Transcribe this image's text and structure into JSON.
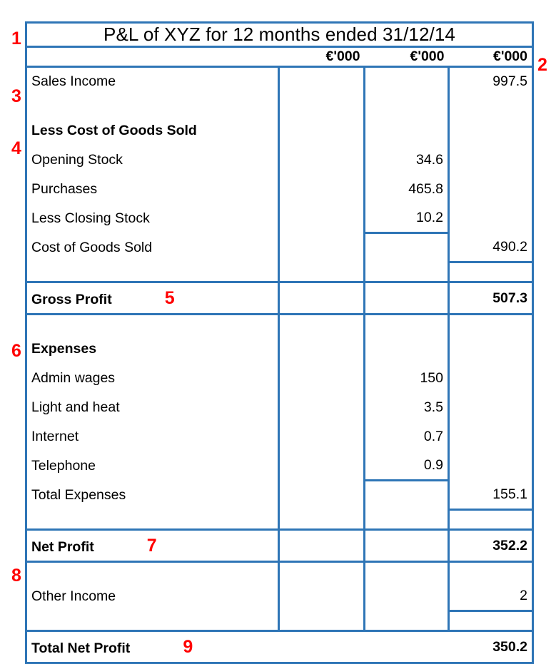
{
  "document": {
    "title": "P&L of XYZ for 12 months ended 31/12/14",
    "currency_headers": [
      "€'000",
      "€'000",
      "€'000"
    ]
  },
  "annotations": {
    "a1": "1",
    "a2": "2",
    "a3": "3",
    "a4": "4",
    "a5": "5",
    "a6": "6",
    "a7": "7",
    "a8": "8",
    "a9": "9"
  },
  "colors": {
    "border": "#2E75B6",
    "annotation": "#FF0000",
    "text": "#000000",
    "background": "#FFFFFF"
  },
  "rows": {
    "sales_income": {
      "label": "Sales Income",
      "col3": "997.5"
    },
    "cogs_heading": {
      "label": "Less Cost of Goods Sold"
    },
    "opening_stock": {
      "label": "Opening Stock",
      "col2": "34.6"
    },
    "purchases": {
      "label": "Purchases",
      "col2": "465.8"
    },
    "less_closing_stock": {
      "label": "Less Closing Stock",
      "col2": "10.2"
    },
    "cost_of_goods_sold": {
      "label": "Cost of Goods Sold",
      "col3": "490.2"
    },
    "gross_profit": {
      "label": "Gross Profit",
      "col3": "507.3"
    },
    "expenses_heading": {
      "label": "Expenses"
    },
    "admin_wages": {
      "label": "Admin wages",
      "col2": "150"
    },
    "light_and_heat": {
      "label": "Light and heat",
      "col2": "3.5"
    },
    "internet": {
      "label": "Internet",
      "col2": "0.7"
    },
    "telephone": {
      "label": "Telephone",
      "col2": "0.9"
    },
    "total_expenses": {
      "label": "Total Expenses",
      "col3": "155.1"
    },
    "net_profit": {
      "label": "Net Profit",
      "col3": "352.2"
    },
    "other_income": {
      "label": "Other Income",
      "col3": "2"
    },
    "total_net_profit": {
      "label": "Total Net Profit",
      "col3": "350.2"
    }
  }
}
